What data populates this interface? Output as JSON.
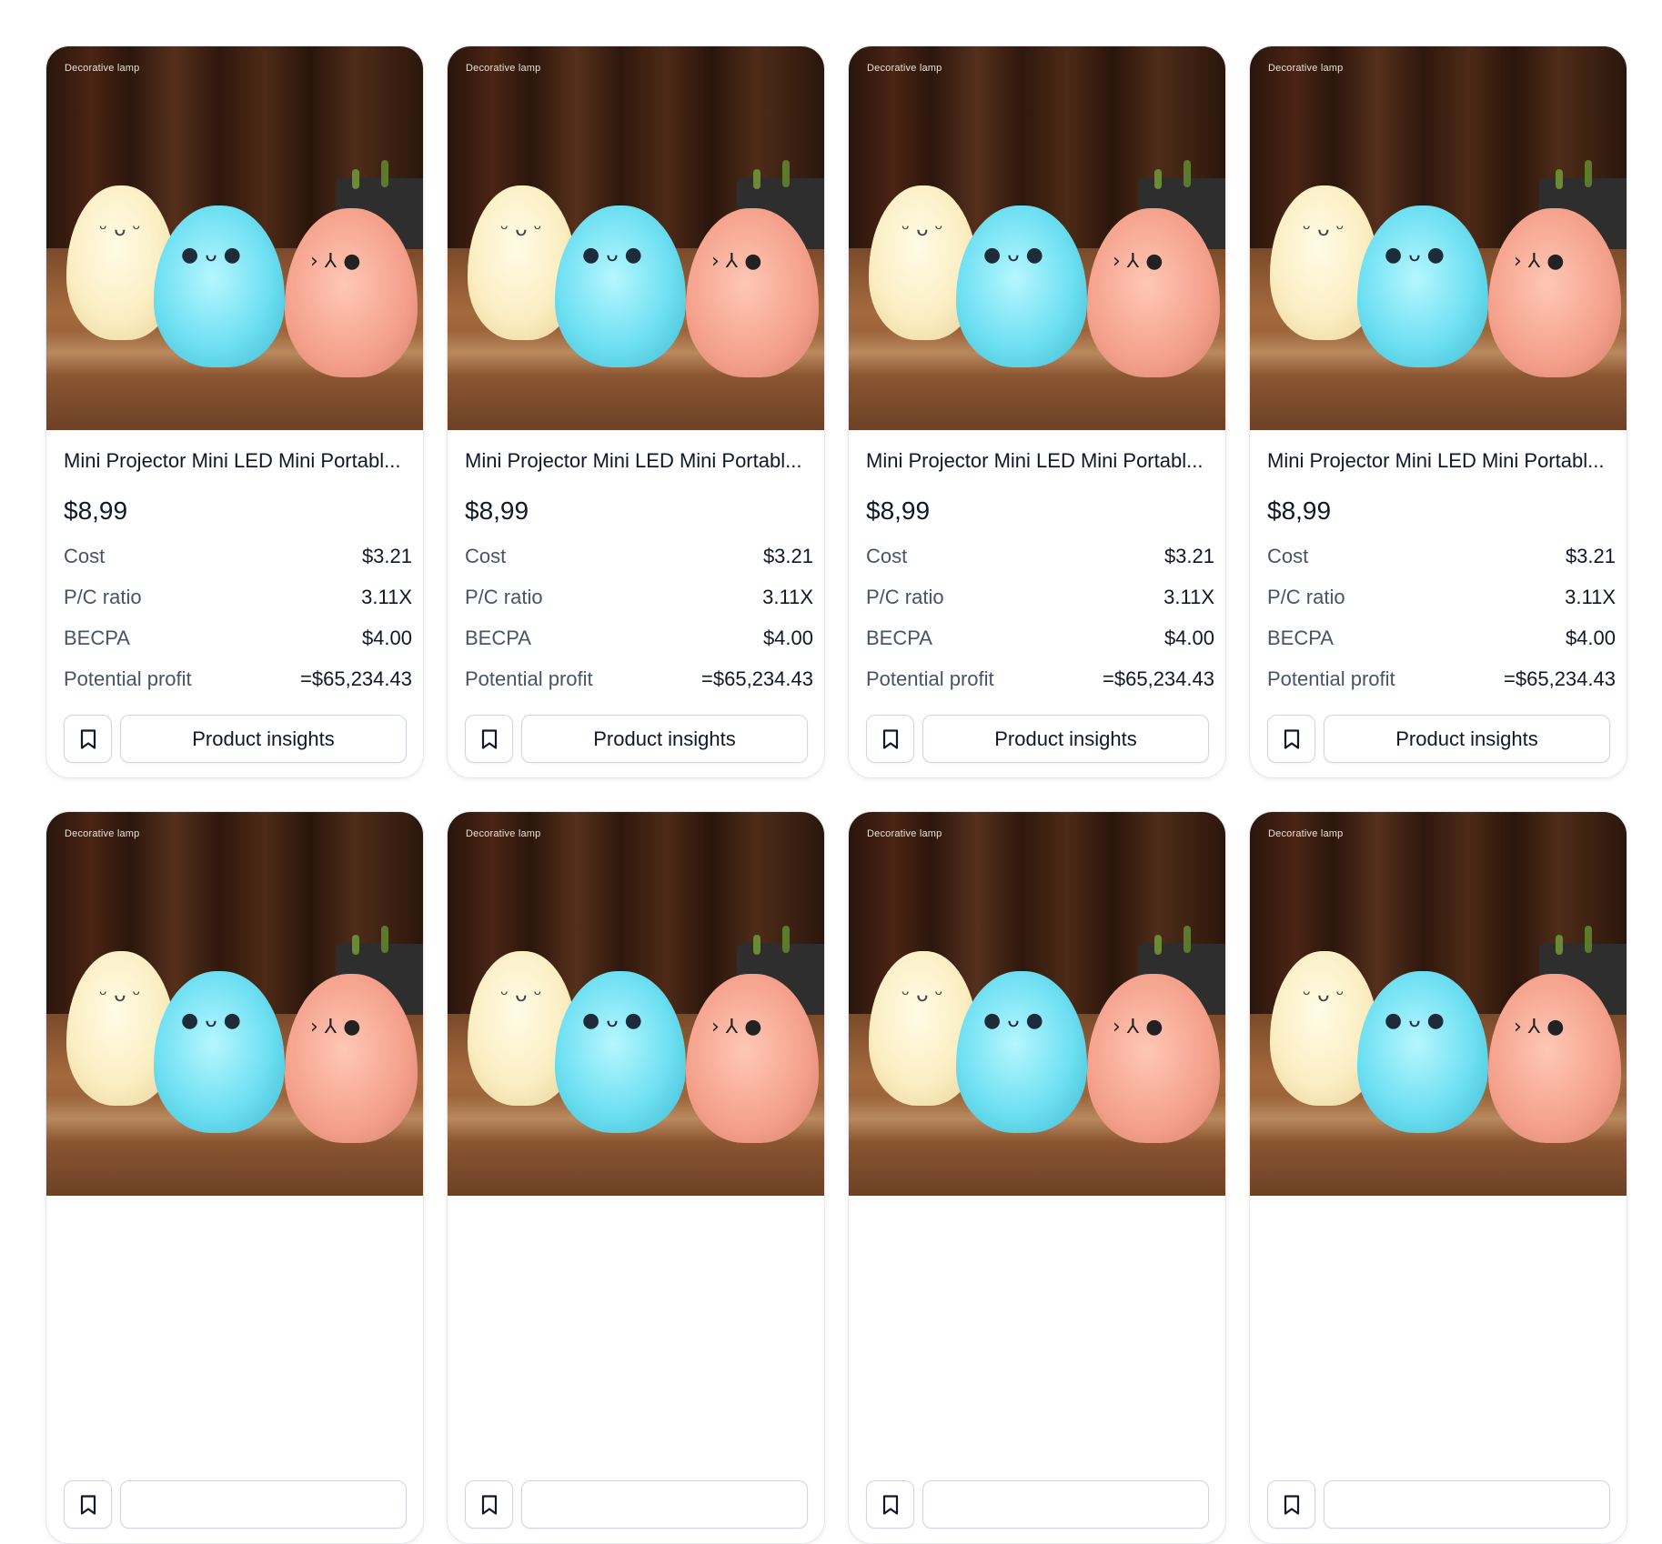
{
  "products": [
    {
      "category_tag": "Decorative lamp",
      "title": "Mini Projector Mini LED Mini Portabl...",
      "price": "$8,99",
      "stats": [
        {
          "label": "Cost",
          "value": "$3.21"
        },
        {
          "label": "P/C ratio",
          "value": "3.11X"
        },
        {
          "label": "BECPA",
          "value": "$4.00"
        },
        {
          "label": "Potential profit",
          "value": "=$65,234.43"
        }
      ],
      "bookmark_icon": "bookmark-icon",
      "insights_label": "Product insights"
    },
    {
      "category_tag": "Decorative lamp",
      "title": "Mini Projector Mini LED Mini Portabl...",
      "price": "$8,99",
      "stats": [
        {
          "label": "Cost",
          "value": "$3.21"
        },
        {
          "label": "P/C ratio",
          "value": "3.11X"
        },
        {
          "label": "BECPA",
          "value": "$4.00"
        },
        {
          "label": "Potential profit",
          "value": "=$65,234.43"
        }
      ],
      "bookmark_icon": "bookmark-icon",
      "insights_label": "Product insights"
    },
    {
      "category_tag": "Decorative lamp",
      "title": "Mini Projector Mini LED Mini Portabl...",
      "price": "$8,99",
      "stats": [
        {
          "label": "Cost",
          "value": "$3.21"
        },
        {
          "label": "P/C ratio",
          "value": "3.11X"
        },
        {
          "label": "BECPA",
          "value": "$4.00"
        },
        {
          "label": "Potential profit",
          "value": "=$65,234.43"
        }
      ],
      "bookmark_icon": "bookmark-icon",
      "insights_label": "Product insights"
    },
    {
      "category_tag": "Decorative lamp",
      "title": "Mini Projector Mini LED Mini Portabl...",
      "price": "$8,99",
      "stats": [
        {
          "label": "Cost",
          "value": "$3.21"
        },
        {
          "label": "P/C ratio",
          "value": "3.11X"
        },
        {
          "label": "BECPA",
          "value": "$4.00"
        },
        {
          "label": "Potential profit",
          "value": "=$65,234.43"
        }
      ],
      "bookmark_icon": "bookmark-icon",
      "insights_label": "Product insights"
    },
    {
      "category_tag": "Decorative lamp"
    },
    {
      "category_tag": "Decorative lamp"
    },
    {
      "category_tag": "Decorative lamp"
    },
    {
      "category_tag": "Decorative lamp"
    }
  ],
  "colors": {
    "text_primary": "#101828",
    "text_secondary": "#475467",
    "border": "#e4e7ec",
    "button_border": "#d0d5dd"
  }
}
